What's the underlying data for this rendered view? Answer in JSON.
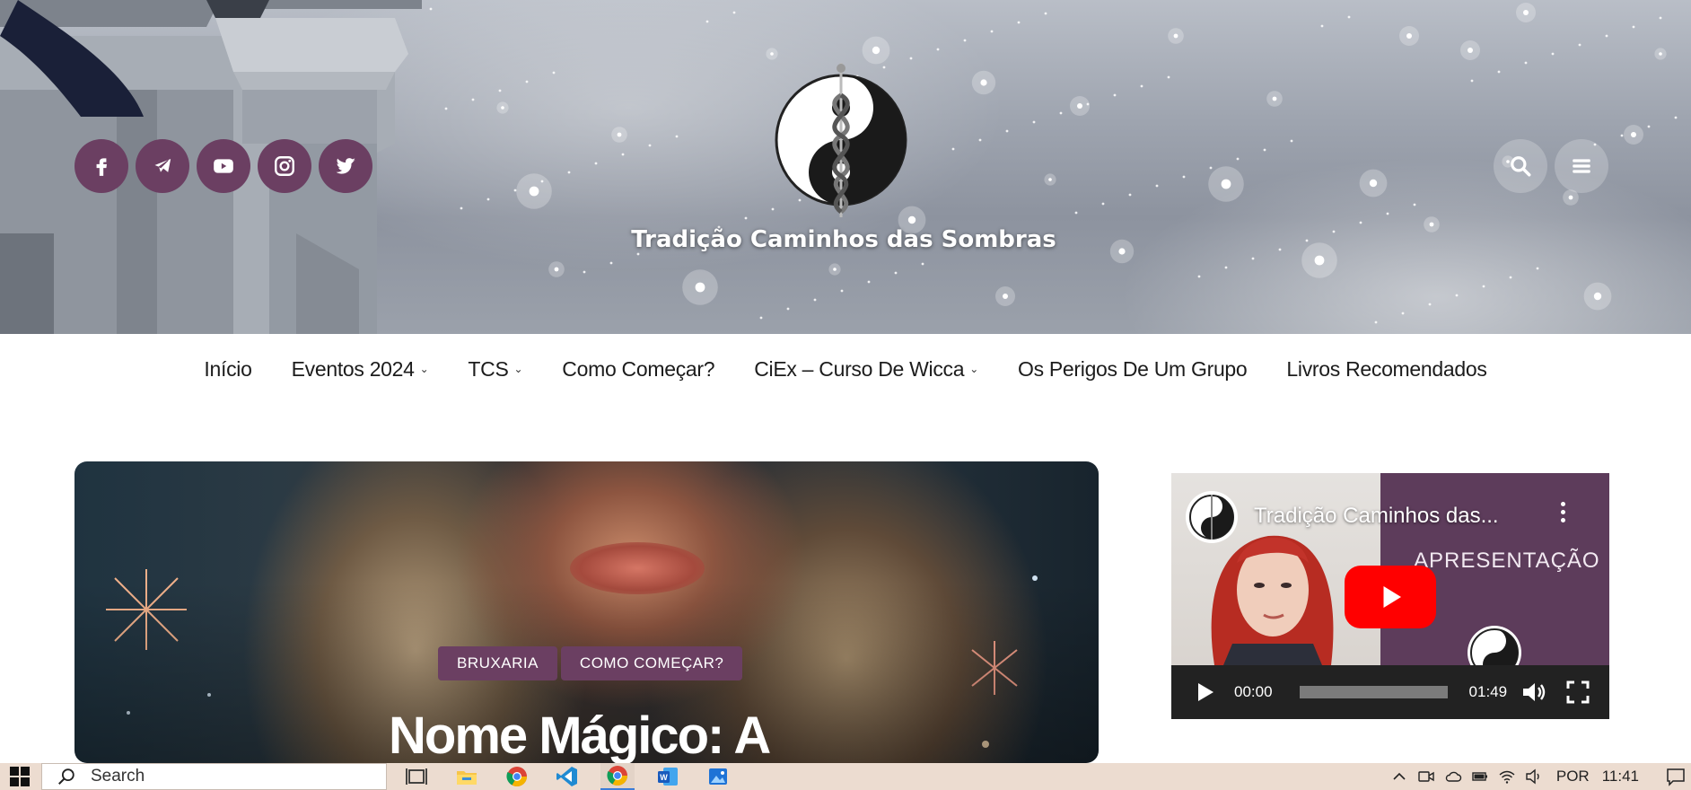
{
  "header": {
    "site_title": "Tradição Caminhos das Sombras",
    "social_icons": [
      "facebook-icon",
      "telegram-icon",
      "youtube-icon",
      "instagram-icon",
      "twitter-icon"
    ],
    "right_icons": [
      "search-icon",
      "menu-icon"
    ]
  },
  "nav": {
    "items": [
      {
        "label": "Início",
        "has_dropdown": false
      },
      {
        "label": "Eventos 2024",
        "has_dropdown": true
      },
      {
        "label": "TCS",
        "has_dropdown": true
      },
      {
        "label": "Como Começar?",
        "has_dropdown": false
      },
      {
        "label": "CiEx – Curso De Wicca",
        "has_dropdown": true
      },
      {
        "label": "Os Perigos De Um Grupo",
        "has_dropdown": false
      },
      {
        "label": "Livros Recomendados",
        "has_dropdown": false
      }
    ]
  },
  "featured_post": {
    "categories": [
      "BRUXARIA",
      "COMO COMEÇAR?"
    ],
    "title": "Nome Mágico: A"
  },
  "video": {
    "title": "Tradição Caminhos das...",
    "overlay_text": "APRESENTAÇÃO",
    "current_time": "00:00",
    "duration": "01:49",
    "progress": 0
  },
  "taskbar": {
    "search_placeholder": "Search",
    "apps": [
      "task-view-icon",
      "file-explorer-icon",
      "chrome-icon",
      "vscode-icon",
      "chrome-active-icon",
      "word-icon",
      "photos-icon"
    ],
    "language": "POR",
    "time": "11:41"
  },
  "colors": {
    "accent_purple": "#6b3f62",
    "youtube_red": "#ff0000"
  }
}
